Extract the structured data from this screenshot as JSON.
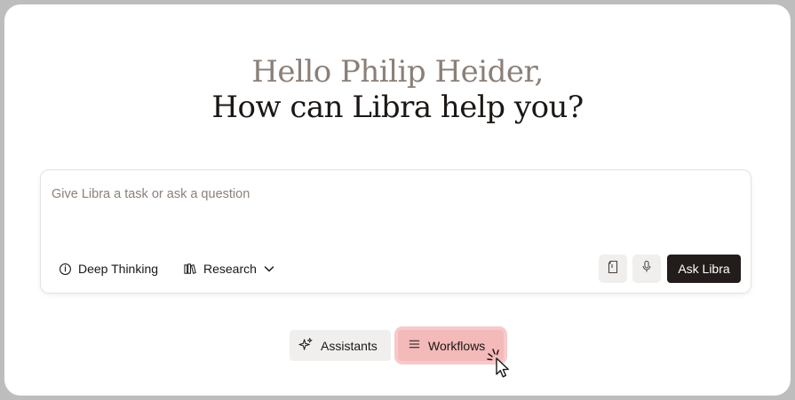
{
  "greeting": {
    "line1": "Hello Philip Heider,",
    "line2": "How can Libra help you?"
  },
  "prompt": {
    "placeholder": "Give Libra a task or ask a question",
    "value": ""
  },
  "toolbar": {
    "deep_thinking_label": "Deep Thinking",
    "deep_thinking_icon": "info-circle-icon",
    "research_label": "Research",
    "research_icon": "books-icon",
    "research_dropdown_icon": "chevron-down-icon",
    "attach_icon": "document-icon",
    "mic_icon": "microphone-icon",
    "ask_label": "Ask Libra"
  },
  "chips": {
    "assistants_label": "Assistants",
    "assistants_icon": "sparkles-icon",
    "workflows_label": "Workflows",
    "workflows_icon": "list-icon"
  },
  "colors": {
    "greeting_muted": "#8b7f77",
    "text_dark": "#1b1714",
    "ask_button_bg": "#221d1a",
    "highlight": "#f4b9b9"
  }
}
